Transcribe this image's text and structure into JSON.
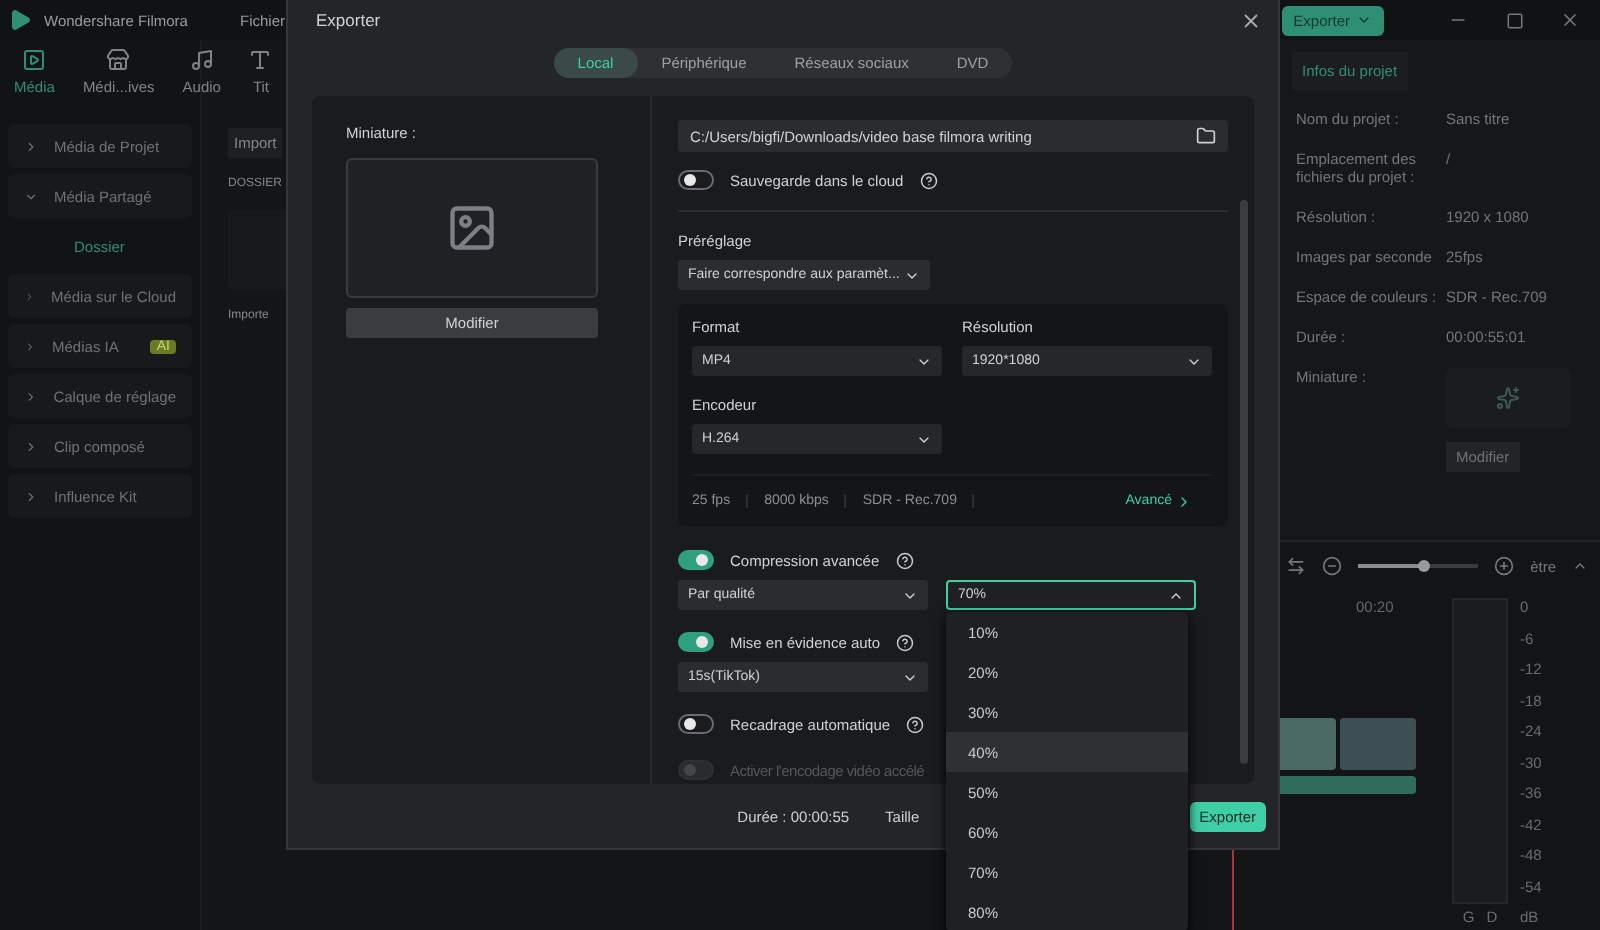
{
  "app": {
    "title": "Wondershare Filmora",
    "menu": [
      "Fichier"
    ],
    "export_button": "Exporter"
  },
  "media_tabs": [
    {
      "label": "Média",
      "selected": true
    },
    {
      "label": "Médi...ives",
      "selected": false
    },
    {
      "label": "Audio",
      "selected": false
    },
    {
      "label": "Tit",
      "selected": false
    }
  ],
  "sidebar": {
    "items": [
      {
        "label": "Média de Projet",
        "expanded": false
      },
      {
        "label": "Média Partagé",
        "expanded": true,
        "children": [
          {
            "label": "Dossier",
            "selected": true
          }
        ]
      },
      {
        "label": "Média sur le Cloud",
        "expanded": false
      },
      {
        "label": "Médias IA",
        "expanded": false,
        "badge": "AI"
      },
      {
        "label": "Calque de réglage",
        "expanded": false
      },
      {
        "label": "Clip composé",
        "expanded": false
      },
      {
        "label": "Influence Kit",
        "expanded": false
      }
    ]
  },
  "media_panel": {
    "import_button": "Import",
    "folder_header": "DOSSIER",
    "import_label": "Importe"
  },
  "project_info": {
    "tab": "Infos du projet",
    "rows": [
      {
        "label": "Nom du projet :",
        "value": "Sans titre"
      },
      {
        "label": "Emplacement des fichiers du projet :",
        "value": "/"
      },
      {
        "label": "Résolution :",
        "value": "1920 x 1080"
      },
      {
        "label": "Images par seconde",
        "value": "25fps"
      },
      {
        "label": "Espace de couleurs :",
        "value": "SDR - Rec.709"
      },
      {
        "label": "Durée :",
        "value": "00:00:55:01"
      }
    ],
    "thumbnail_label": "Miniature :",
    "modify_button": "Modifier"
  },
  "timeline": {
    "zoom": {
      "level": 0.55
    },
    "fit_label": "ètre",
    "ruler": [
      "00:20"
    ],
    "meter_scale": [
      "0",
      "-6",
      "-12",
      "-18",
      "-24",
      "-30",
      "-36",
      "-42",
      "-48",
      "-54",
      "dB"
    ],
    "channels": [
      "G",
      "D"
    ]
  },
  "dialog": {
    "title": "Exporter",
    "tabs": [
      {
        "label": "Local",
        "selected": true
      },
      {
        "label": "Périphérique",
        "selected": false
      },
      {
        "label": "Réseaux sociaux",
        "selected": false
      },
      {
        "label": "DVD",
        "selected": false
      }
    ],
    "thumbnail": {
      "label": "Miniature :",
      "button": "Modifier"
    },
    "path": "C:/Users/bigfi/Downloads/video base filmora writing",
    "cloud_backup": {
      "label": "Sauvegarde dans le cloud",
      "on": false
    },
    "preset": {
      "label": "Préréglage",
      "value": "Faire correspondre aux paramèt..."
    },
    "format": {
      "label": "Format",
      "value": "MP4"
    },
    "resolution": {
      "label": "Résolution",
      "value": "1920*1080"
    },
    "encoder": {
      "label": "Encodeur",
      "value": "H.264"
    },
    "specs": [
      "25 fps",
      "8000 kbps",
      "SDR - Rec.709"
    ],
    "advanced_link": "Avancé",
    "options": [
      {
        "label": "Compression avancée",
        "on": true,
        "disabled": false,
        "help": true,
        "selects": [
          {
            "value": "Par qualité",
            "open": false
          },
          {
            "value": "70%",
            "open": true
          }
        ]
      },
      {
        "label": "Mise en évidence auto",
        "on": true,
        "disabled": false,
        "help": true,
        "selects": [
          {
            "value": "15s(TikTok)",
            "open": false
          }
        ]
      },
      {
        "label": "Recadrage automatique",
        "on": false,
        "disabled": false,
        "help": true
      },
      {
        "label": "Activer l'encodage vidéo accélé",
        "on": false,
        "disabled": true,
        "help": false
      }
    ],
    "dropdown": [
      {
        "label": "10%",
        "selected": false
      },
      {
        "label": "20%",
        "selected": false
      },
      {
        "label": "30%",
        "selected": false
      },
      {
        "label": "40%",
        "selected": true
      },
      {
        "label": "50%",
        "selected": false
      },
      {
        "label": "60%",
        "selected": false
      },
      {
        "label": "70%",
        "selected": false
      },
      {
        "label": "80%",
        "selected": false
      }
    ],
    "footer": {
      "duration": "Durée : 00:00:55",
      "size_label": "Taille",
      "export_button": "Exporter"
    }
  }
}
